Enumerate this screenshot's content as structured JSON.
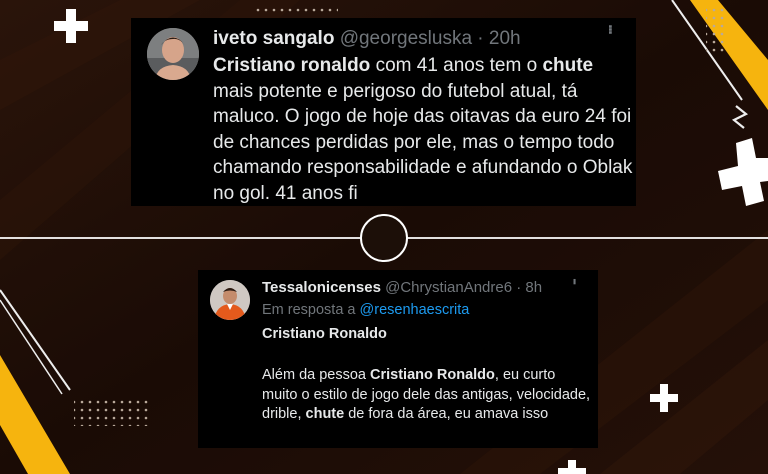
{
  "tweet_top": {
    "display_name": "iveto sangalo",
    "handle": "@georgesluska",
    "separator": " · ",
    "time": "20h",
    "text": {
      "p1_bold": "Cristiano ronaldo",
      "p2": " com 41 anos tem o ",
      "p3_bold": "chute",
      "p4": " mais potente e perigoso do futebol atual, tá maluco. O jogo de hoje das oitavas da euro 24 foi de chances perdidas por ele, mas o tempo todo chamando responsabilidade e afundando o Oblak no gol. 41 anos fi"
    },
    "more_icon": "more-dots-icon"
  },
  "tweet_bottom": {
    "display_name": "Tessalonicenses",
    "handle": "@ChrystianAndre6",
    "separator": " · ",
    "time": "8h",
    "reply_prefix": "Em resposta a ",
    "reply_handle": "@resenhaescrita",
    "title": "Cristiano Ronaldo",
    "text": {
      "p1": "Além da pessoa ",
      "p2_bold": "Cristiano Ronaldo",
      "p3": ", eu curto muito o estilo de jogo dele das antigas, velocidade, drible, ",
      "p4_bold": "chute",
      "p5": " de fora da área, eu amava isso"
    },
    "more_icon": "more-dots-icon"
  },
  "colors": {
    "background": "#1c0f08",
    "accent_yellow": "#f6b40e",
    "tweet_bg": "#000000",
    "text": "#e7e9ea",
    "muted": "#71767b",
    "link": "#1d9bf0"
  }
}
